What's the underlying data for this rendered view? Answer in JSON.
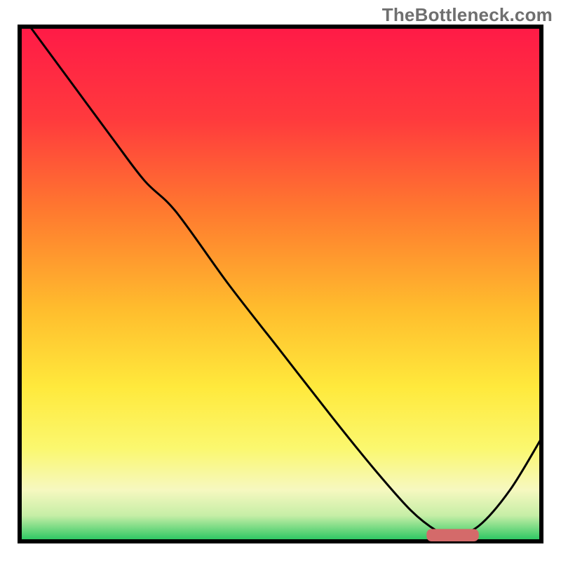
{
  "watermark": "TheBottleneck.com",
  "chart_data": {
    "type": "line",
    "title": "",
    "xlabel": "",
    "ylabel": "",
    "xlim": [
      0,
      100
    ],
    "ylim": [
      0,
      100
    ],
    "legend": null,
    "background": {
      "type": "vertical-gradient",
      "stops": [
        {
          "pct": 0,
          "color": "#ff1a47"
        },
        {
          "pct": 18,
          "color": "#ff3a3d"
        },
        {
          "pct": 36,
          "color": "#ff7a2f"
        },
        {
          "pct": 55,
          "color": "#ffbd2d"
        },
        {
          "pct": 70,
          "color": "#ffe93c"
        },
        {
          "pct": 82,
          "color": "#fbf86f"
        },
        {
          "pct": 90,
          "color": "#f6f8c0"
        },
        {
          "pct": 95,
          "color": "#c6eea6"
        },
        {
          "pct": 100,
          "color": "#22c55e"
        }
      ]
    },
    "series": [
      {
        "name": "bottleneck-curve",
        "stroke": "#000000",
        "stroke_width": 3,
        "x": [
          2,
          10,
          18,
          24,
          30,
          40,
          50,
          60,
          68,
          75,
          80,
          83,
          88,
          94,
          100
        ],
        "values": [
          100,
          89,
          78,
          70,
          64,
          50,
          37,
          24,
          14,
          6,
          2,
          1,
          3,
          10,
          20
        ]
      }
    ],
    "annotations": [
      {
        "name": "optimal-zone",
        "shape": "rounded-rect",
        "color": "#d46a6a",
        "x0": 78,
        "x1": 88,
        "y": 1.2,
        "height": 2.4
      }
    ]
  }
}
